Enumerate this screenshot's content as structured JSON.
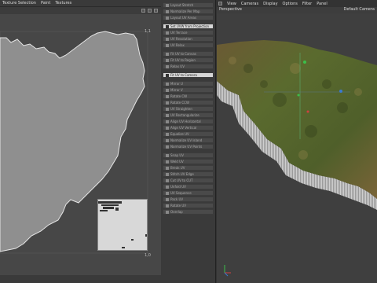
{
  "uv_editor": {
    "menu": [
      "Texture Selection",
      "Paint",
      "Textures"
    ],
    "corner_top_label": "1,1",
    "corner_bottom_label": "1,0"
  },
  "tool_panel": {
    "items": [
      {
        "label": "Layout Stretch",
        "active": false,
        "gap": false
      },
      {
        "label": "Normalize Per Map",
        "active": false,
        "gap": false
      },
      {
        "label": "Layout UV Areas",
        "active": false,
        "gap": false
      },
      {
        "label": "Set UVW from Projection",
        "active": true,
        "gap": true
      },
      {
        "label": "UV Terrace",
        "active": false,
        "gap": false
      },
      {
        "label": "UV Resolution",
        "active": false,
        "gap": false
      },
      {
        "label": "UV Relax",
        "active": false,
        "gap": false
      },
      {
        "label": "Fit UV to Canvas",
        "active": false,
        "gap": true
      },
      {
        "label": "Fit UV to Region",
        "active": false,
        "gap": false
      },
      {
        "label": "Relax UV",
        "active": false,
        "gap": false
      },
      {
        "label": "Fit UV to Camera",
        "active": true,
        "gap": true
      },
      {
        "label": "Mirror U",
        "active": false,
        "gap": true
      },
      {
        "label": "Mirror V",
        "active": false,
        "gap": false
      },
      {
        "label": "Rotate CW",
        "active": false,
        "gap": false
      },
      {
        "label": "Rotate CCW",
        "active": false,
        "gap": false
      },
      {
        "label": "UV Straighten",
        "active": false,
        "gap": false
      },
      {
        "label": "UV Rectangularize",
        "active": false,
        "gap": false
      },
      {
        "label": "Align UV Horizontal",
        "active": false,
        "gap": false
      },
      {
        "label": "Align UV Vertical",
        "active": false,
        "gap": false
      },
      {
        "label": "Equalize UV",
        "active": false,
        "gap": false
      },
      {
        "label": "Normalize UV Island",
        "active": false,
        "gap": false
      },
      {
        "label": "Normalize UV Points",
        "active": false,
        "gap": false
      },
      {
        "label": "Snap UV",
        "active": false,
        "gap": true
      },
      {
        "label": "Weld UV",
        "active": false,
        "gap": false
      },
      {
        "label": "Break UV",
        "active": false,
        "gap": false
      },
      {
        "label": "Stitch UV Edge",
        "active": false,
        "gap": false
      },
      {
        "label": "Cut UV to CUT",
        "active": false,
        "gap": false
      },
      {
        "label": "Unfold UV",
        "active": false,
        "gap": false
      },
      {
        "label": "UV Sequence",
        "active": false,
        "gap": false
      },
      {
        "label": "Pack UV",
        "active": false,
        "gap": false
      },
      {
        "label": "Rotate UV",
        "active": false,
        "gap": false
      },
      {
        "label": "Overlap",
        "active": false,
        "gap": false
      }
    ]
  },
  "viewport": {
    "menu": [
      "View",
      "Cameras",
      "Display",
      "Options",
      "Filter",
      "Panel"
    ],
    "projection": "Perspective",
    "camera": "Default Camera"
  },
  "colors": {
    "uv_shape": "#8f8f8f",
    "uv_outline": "#e0e0e0",
    "active_button": "#d6d6d6",
    "terrain_green": "#5a6a2e",
    "terrain_brown": "#7a6438"
  }
}
